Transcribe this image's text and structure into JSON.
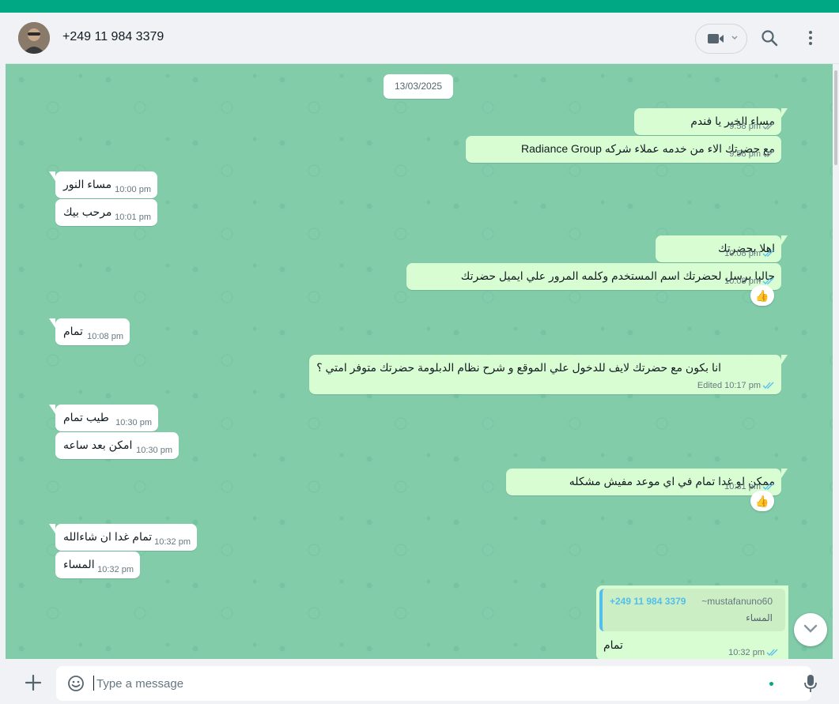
{
  "colors": {
    "accent": "#00a884",
    "chat_bg": "#82ccaa",
    "out_bubble": "#d9fdd3",
    "in_bubble": "#ffffff",
    "tick_read": "#53bdeb"
  },
  "header": {
    "contact_name": "+249 11 984 3379",
    "icons": [
      "avatar",
      "video-call-icon",
      "chevron-down-icon",
      "search-icon",
      "menu-icon"
    ]
  },
  "chat": {
    "date_divider": "13/03/2025",
    "messages": [
      {
        "dir": "out",
        "text": "مساء الخير يا فندم",
        "time": "9:58 pm"
      },
      {
        "dir": "out",
        "text": "مع حضرتك الاء  من خدمه عملاء شركه Radiance Group",
        "time": "9:58 pm"
      },
      {
        "dir": "in",
        "text": "مساء النور",
        "time": "10:00 pm"
      },
      {
        "dir": "in",
        "text": "مرحب بيك",
        "time": "10:01 pm"
      },
      {
        "dir": "out",
        "text": "اهلا بحضرتك",
        "time": "10:08 pm"
      },
      {
        "dir": "out",
        "text": "حاليا برسل لحضرتك اسم المستخدم وكلمه المرور علي ايميل حضرتك",
        "time": "10:08 pm",
        "reaction": "👍"
      },
      {
        "dir": "in",
        "text": "تمام",
        "time": "10:08 pm"
      },
      {
        "dir": "out",
        "text": "انا بكون مع حضرتك لايف للدخول علي الموقع و شرح نظام الدبلومة حضرتك متوفر امتي ؟",
        "time": "Edited 10:17 pm"
      },
      {
        "dir": "in",
        "text": "طيب تمام",
        "time": "10:30 pm"
      },
      {
        "dir": "in",
        "text": "امكن بعد ساعه",
        "time": "10:30 pm"
      },
      {
        "dir": "out",
        "text": "ممكن لو غدا تمام في اي موعد مفيش مشكله",
        "time": "10:31 pm",
        "reaction": "👍"
      },
      {
        "dir": "in",
        "text": "تمام غدا ان شاءالله",
        "time": "10:32 pm"
      },
      {
        "dir": "in",
        "text": "المساء",
        "time": "10:32 pm"
      }
    ],
    "quoted_reply": {
      "quoted_name": "+249 11 984 3379",
      "quoted_user": "~mustafanuno60",
      "quoted_text": "المساء",
      "text": "تمام",
      "time": "10:32 pm"
    }
  },
  "composer": {
    "placeholder": "Type a message",
    "icons": [
      "plus-icon",
      "emoji-icon",
      "mic-icon"
    ]
  }
}
